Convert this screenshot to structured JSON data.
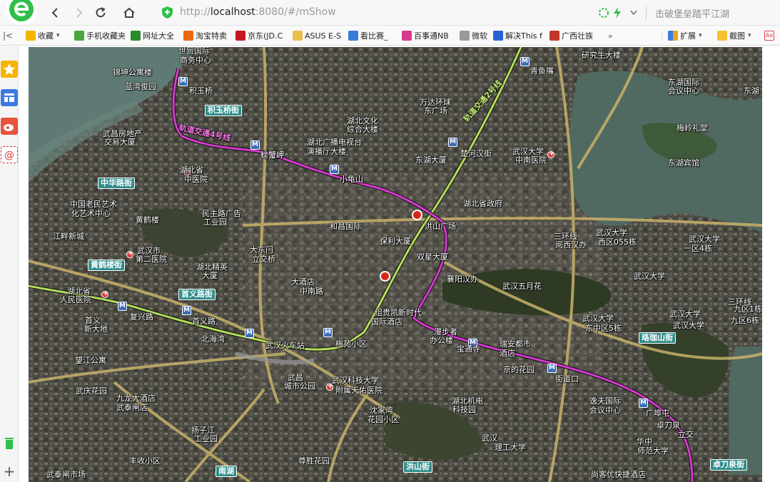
{
  "browser": {
    "url_prefix": "http://",
    "url_host": "localhost",
    "url_rest": ":8080/#/mShow",
    "search_text": "击破堡垒踏平江湖",
    "icons": [
      "logo-icon",
      "back-icon",
      "forward-icon",
      "reload-icon",
      "home-icon",
      "shield-icon",
      "extension-icon",
      "bolt-icon",
      "dropdown-icon"
    ]
  },
  "bookmarks": [
    {
      "label": "收藏",
      "icon": "star-icon",
      "color": "#f5b400",
      "dropdown": true
    },
    {
      "label": "手机收藏夹",
      "icon": "phone-icon",
      "color": "#49a73b"
    },
    {
      "label": "网址大全",
      "icon": "globe-icon",
      "color": "#2b8b2b"
    },
    {
      "label": "淘宝特卖",
      "icon": "taobao-icon",
      "color": "#e86a10"
    },
    {
      "label": "京东(JD.C",
      "icon": "jd-icon",
      "color": "#c81623"
    },
    {
      "label": "ASUS E-S",
      "icon": "folder-icon",
      "color": "#e8c04a"
    },
    {
      "label": "看比赛_",
      "icon": "ball-icon",
      "color": "#3a7bd5"
    },
    {
      "label": "百事通NB",
      "icon": "face-icon",
      "color": "#d63a8a"
    },
    {
      "label": "微软",
      "icon": "page-icon",
      "color": "#9a9a9a"
    },
    {
      "label": "解决This f",
      "icon": "paw-icon",
      "color": "#2a62d6"
    },
    {
      "label": "广西壮族",
      "icon": "seal-icon",
      "color": "#c0392b"
    }
  ],
  "bookmarks_more": "»",
  "bookmarks_right": [
    {
      "label": "扩展",
      "icon": "grid-icon",
      "dropdown": true
    },
    {
      "label": "截图",
      "icon": "scissors-icon",
      "dropdown": true
    }
  ],
  "sidebar_icons": [
    "favorites-icon",
    "panel-icon",
    "weibo-icon",
    "mail-icon",
    "trash-icon",
    "add-icon"
  ],
  "map": {
    "metro_line_label": "轨道交通4号线",
    "metro_line2_label": "轨道交通2号线",
    "street_badges": [
      "积玉桥街",
      "中华路街",
      "黄鹤楼街",
      "首义路街",
      "南湖",
      "洪山街",
      "珞珈山街",
      "卓刀泉街"
    ],
    "labels": [
      "世贸国际",
      "商务中心",
      "锦坤公寓楼",
      "积玉桥",
      "蓝湾俊园",
      "武昌房地产",
      "交易大厦",
      "湖北省",
      "中医院",
      "螃蟹岬",
      "湖北广播电视台",
      "演播厅大楼",
      "湖北文化",
      "综合大楼",
      "万达环球",
      "东广场",
      "青鱼嘴",
      "研究生大楼",
      "楚河汉街",
      "东湖大厦",
      "武汉大学",
      "中南医院",
      "东湖国际",
      "会议中心",
      "东湖",
      "梅岭礼堂",
      "东湖宾馆",
      "小龟山",
      "湖北省政府",
      "中国老民艺术",
      "化艺术中心",
      "黄鹤楼",
      "民主路广告",
      "工业园",
      "和昌国际",
      "江畔新城",
      "洪山广场",
      "保利大厦",
      "双星大厦",
      "大东门",
      "立交桥",
      "武汉市",
      "第二医院",
      "湖北精英",
      "大厦",
      "武汉大学",
      "西区055栋",
      "武汉大学",
      "一区4栋",
      "武汉大学",
      "三环线",
      "三环线",
      "阅西汉办",
      "襄阳汉办",
      "武汉五月花",
      "大酒店",
      "中南路",
      "湖北省",
      "人民医院",
      "复兴路",
      "首义路",
      "首义",
      "新大地",
      "北海湾",
      "组贵凯新时代",
      "国际酒店",
      "漫步者",
      "办公楼",
      "瑞安都市",
      "酒店",
      "宝通寺",
      "武汉大学",
      "东中区5栋",
      "武汉大学",
      "九区1栋",
      "武汉大学",
      "九区6栋",
      "武汉火车站",
      "梅苑小区",
      "望江公寓",
      "京的花园",
      "街道口",
      "武庆花园",
      "九龙大酒店",
      "武泰闸店",
      "武昌",
      "城市公园",
      "武汉科技大学",
      "附属天佑医院",
      "湖北机电",
      "科技园",
      "逸夫国际",
      "会议中心",
      "广埠屯",
      "卓刀泉",
      "立交",
      "华中",
      "师范大学",
      "武汉",
      "理工大学",
      "沈家湾",
      "花园小区",
      "扬子江",
      "工业园",
      "丰收小区",
      "武泰闸市场",
      "尊胜花园",
      "尚客优快捷酒店"
    ]
  }
}
